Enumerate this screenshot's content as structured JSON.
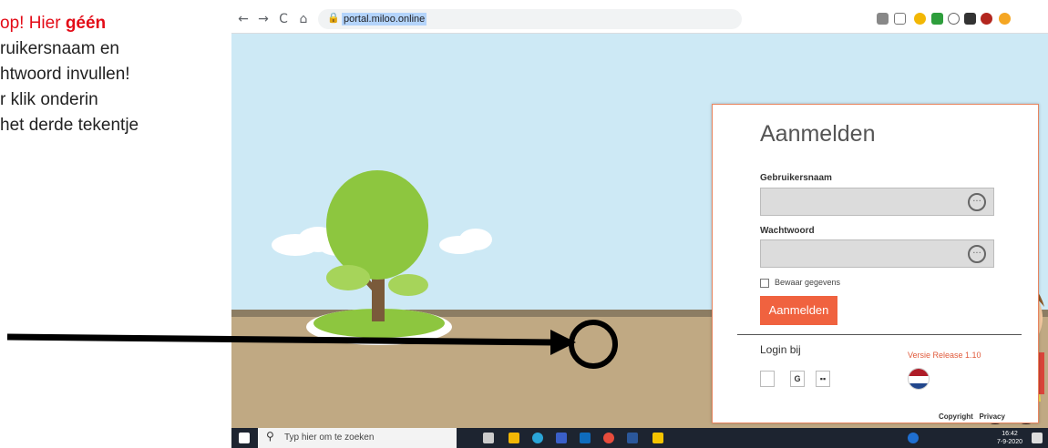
{
  "note": {
    "line1_a": "op! Hier ",
    "line1_b": "géén",
    "line2": "ruikersnaam en",
    "line3": "htwoord invullen!",
    "line4": "r klik onderin",
    "line5": "het derde tekentje"
  },
  "browser": {
    "url": "portal.miloo.online",
    "nav": {
      "back": "←",
      "forward": "→",
      "reload": "C",
      "home": "⌂"
    }
  },
  "login": {
    "title": "Aanmelden",
    "username_label": "Gebruikersnaam",
    "username_value": "",
    "password_label": "Wachtwoord",
    "password_value": "",
    "remember_label": "Bewaar gegevens",
    "remember_checked": false,
    "submit_label": "Aanmelden",
    "login_with_label": "Login bij",
    "version": "Versie Release 1.10",
    "sso_buttons": [
      "",
      "G",
      "▪▪"
    ]
  },
  "footer": {
    "copyright": "Copyright",
    "privacy": "Privacy"
  },
  "taskbar": {
    "search_placeholder": "Typ hier om te zoeken",
    "time": "16:42",
    "date": "7-9-2020"
  },
  "colors": {
    "accent": "#f0623f",
    "annotation_red": "#e30b17",
    "sky": "#cde9f5",
    "ground": "#c0a983"
  }
}
